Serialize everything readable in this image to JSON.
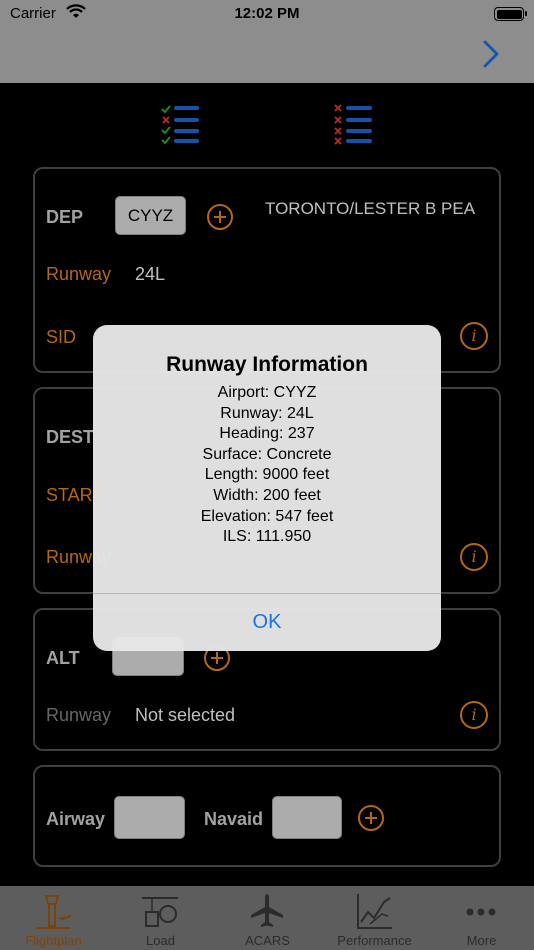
{
  "status_bar": {
    "carrier": "Carrier",
    "time": "12:02 PM"
  },
  "departure": {
    "label": "DEP",
    "airport_code": "CYYZ",
    "airport_name": "TORONTO/LESTER B PEA",
    "runway_label": "Runway",
    "runway_value": "24L",
    "sid_label": "SID"
  },
  "destination": {
    "label": "DEST",
    "star_label": "STAR",
    "runway_label": "Runway"
  },
  "alternate": {
    "label": "ALT",
    "airport_code": "",
    "runway_label": "Runway",
    "runway_value": "Not selected"
  },
  "route": {
    "airway_label": "Airway",
    "airway_value": "",
    "navaid_label": "Navaid",
    "navaid_value": ""
  },
  "alert": {
    "title": "Runway Information",
    "lines": [
      "Airport: CYYZ",
      "Runway: 24L",
      "Heading: 237",
      "Surface: Concrete",
      "Length: 9000 feet",
      "Width: 200 feet",
      "Elevation: 547 feet",
      "ILS: 111.950"
    ],
    "ok_label": "OK"
  },
  "tabs": [
    {
      "label": "Flightplan",
      "icon": "tower-icon",
      "active": true
    },
    {
      "label": "Load",
      "icon": "load-icon",
      "active": false
    },
    {
      "label": "ACARS",
      "icon": "airplane-icon",
      "active": false
    },
    {
      "label": "Performance",
      "icon": "performance-chart-icon",
      "active": false
    },
    {
      "label": "More",
      "icon": "more-dots-icon",
      "active": false
    }
  ],
  "colors": {
    "accent": "#f08a1c",
    "link_blue": "#1a73e8",
    "card_border": "#555555"
  }
}
